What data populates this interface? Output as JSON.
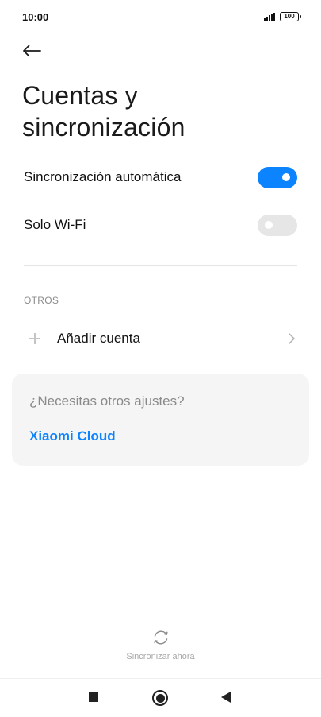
{
  "status_bar": {
    "time": "10:00",
    "battery": "100",
    "icons": [
      "signal-icon",
      "battery-icon"
    ]
  },
  "header": {
    "back_icon": "arrow-left-icon",
    "title": "Cuentas y sincronización"
  },
  "settings": [
    {
      "label": "Sincronización automática",
      "toggle": true
    },
    {
      "label": "Solo Wi-Fi",
      "toggle": false
    }
  ],
  "others": {
    "header": "OTROS",
    "add_account_label": "Añadir cuenta",
    "icons": [
      "plus-icon",
      "chevron-right-icon"
    ]
  },
  "card": {
    "question": "¿Necesitas otros ajustes?",
    "link": "Xiaomi Cloud"
  },
  "sync_now": {
    "label": "Sincronizar ahora",
    "icon": "sync-icon"
  },
  "nav_bar": {
    "icons": [
      "recents-square-icon",
      "home-circle-icon",
      "back-triangle-icon"
    ]
  },
  "colors": {
    "accent": "#0d84ff",
    "toggle_off": "#e6e6e6",
    "card_bg": "#f5f5f5"
  }
}
